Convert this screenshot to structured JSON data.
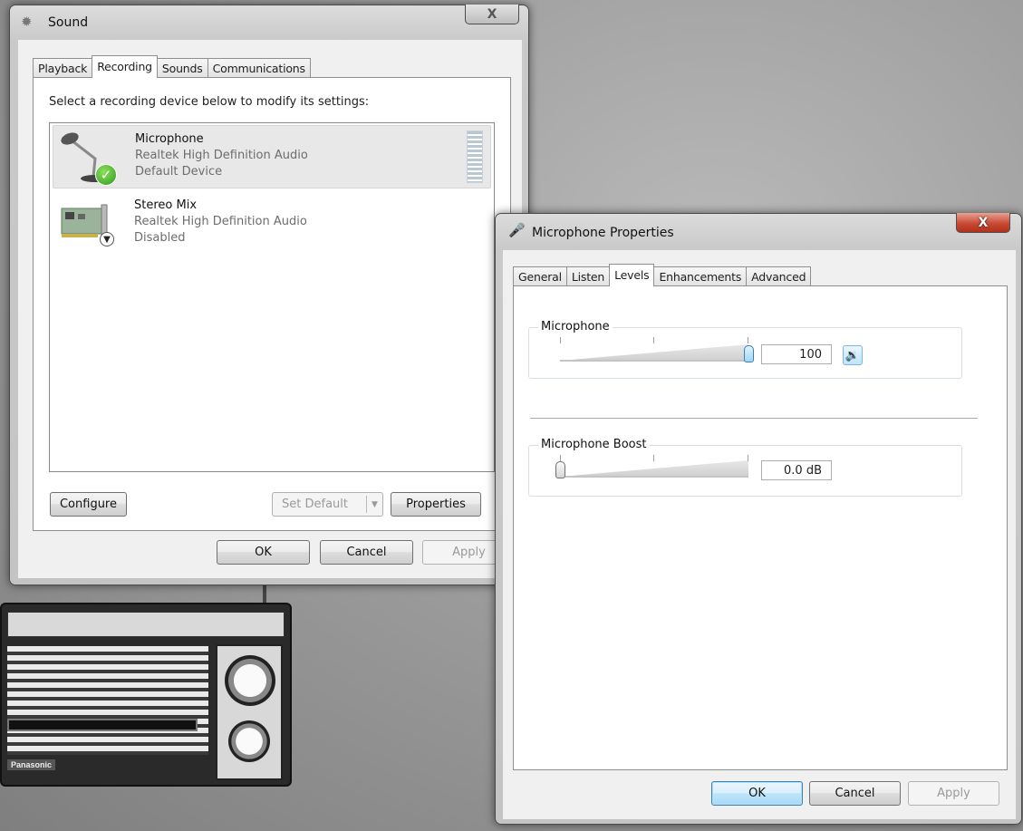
{
  "sound_window": {
    "title": "Sound",
    "close_label": "X",
    "tabs": [
      {
        "label": "Playback"
      },
      {
        "label": "Recording"
      },
      {
        "label": "Sounds"
      },
      {
        "label": "Communications"
      }
    ],
    "active_tab": "Recording",
    "hint": "Select a recording device below to modify its settings:",
    "devices": [
      {
        "name": "Microphone",
        "driver": "Realtek High Definition Audio",
        "status": "Default Device",
        "icon": "microphone-icon",
        "badge": "default-check-icon"
      },
      {
        "name": "Stereo Mix",
        "driver": "Realtek High Definition Audio",
        "status": "Disabled",
        "icon": "sound-card-icon",
        "badge": "disabled-down-arrow-icon"
      }
    ],
    "buttons": {
      "configure": "Configure",
      "set_default": "Set Default",
      "properties": "Properties",
      "ok": "OK",
      "cancel": "Cancel",
      "apply": "Apply"
    }
  },
  "properties_window": {
    "title": "Microphone Properties",
    "close_label": "X",
    "tabs": [
      {
        "label": "General"
      },
      {
        "label": "Listen"
      },
      {
        "label": "Levels"
      },
      {
        "label": "Enhancements"
      },
      {
        "label": "Advanced"
      }
    ],
    "active_tab": "Levels",
    "microphone": {
      "label": "Microphone",
      "value": "100",
      "level_fraction": 1.0,
      "mute_icon": "speaker-icon"
    },
    "boost": {
      "label": "Microphone Boost",
      "value": "0.0 dB",
      "level_fraction": 0.0
    },
    "buttons": {
      "ok": "OK",
      "cancel": "Cancel",
      "apply": "Apply"
    }
  },
  "wallpaper": {
    "brand_text": "Panasonic"
  }
}
